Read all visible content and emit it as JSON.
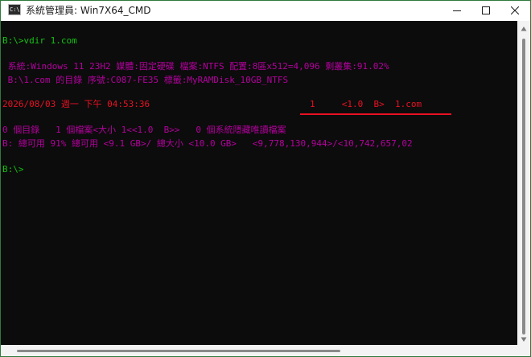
{
  "window": {
    "title": "系統管理員: Win7X64_CMD",
    "icon": "console-app-icon",
    "icon_text": "C:\\"
  },
  "colors": {
    "console_bg": "#0c0c0c",
    "green": "#13c213",
    "magenta": "#b4009e",
    "red": "#e81123",
    "window_border": "#2f7a3b"
  },
  "console": {
    "command_line": "B:\\>vdir 1.com",
    "volume_info": " 系統:Windows 11 23H2 媒體:固定硬碟 檔案:NTFS 配置:8區x512=4,096 剩叢集:91.02%",
    "directory_info": " B:\\1.com 的目錄 序號:C087-FE35 標籤:MyRAMDisk_10GB_NTFS",
    "timestamp": "2026/08/03 週一 下午 04:53:36",
    "file_entry": "1     <1.0  B>  1.com",
    "summary_line": "0 個目錄   1 個檔案<大小 1<<1.0  B>>   0 個系統隱藏唯讀檔案",
    "space_line": "B: 總可用 91% 總可用 <9.1 GB>/ 總大小 <10.0 GB>   <9,778,130,944>/<10,742,657,02",
    "prompt": "B:\\>"
  }
}
